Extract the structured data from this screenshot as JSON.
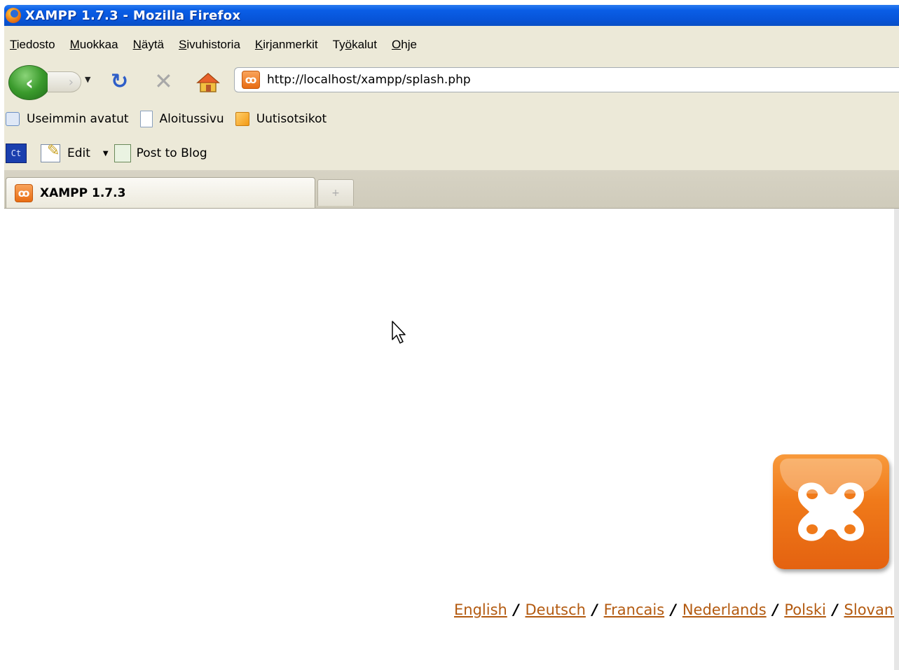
{
  "window": {
    "title": "XAMPP 1.7.3 - Mozilla Firefox"
  },
  "menu": [
    {
      "label": "Tiedosto",
      "access": "T",
      "rest": "iedosto"
    },
    {
      "label": "Muokkaa",
      "access": "M",
      "rest": "uokkaa"
    },
    {
      "label": "Näytä",
      "access": "N",
      "rest": "äytä"
    },
    {
      "label": "Sivuhistoria",
      "access": "S",
      "rest": "ivuhistoria"
    },
    {
      "label": "Kirjanmerkit",
      "access": "K",
      "rest": "irjanmerkit"
    },
    {
      "label": "Työkalut",
      "pre": "Ty",
      "access": "ö",
      "rest": "kalut"
    },
    {
      "label": "Ohje",
      "access": "O",
      "rest": "hje"
    }
  ],
  "nav": {
    "url": "http://localhost/xampp/splash.php"
  },
  "bookmarks": [
    {
      "label": "Useimmin avatut",
      "icon": "most-visited-icon"
    },
    {
      "label": "Aloitussivu",
      "icon": "page-icon"
    },
    {
      "label": "Uutisotsikot",
      "icon": "rss-icon"
    }
  ],
  "extensions": {
    "ct_label": "Ct",
    "edit_label": "Edit",
    "blog_label": "Post to Blog"
  },
  "tabs": [
    {
      "label": "XAMPP 1.7.3",
      "active": true
    }
  ],
  "newtab_symbol": "+",
  "page": {
    "languages": [
      "English",
      "Deutsch",
      "Francais",
      "Nederlands",
      "Polski",
      "Slovane"
    ],
    "separator": "/"
  },
  "colors": {
    "titlebar": "#0754d8",
    "chrome": "#ece9d8",
    "xampp_orange": "#f07a1a",
    "link": "#b35a10"
  }
}
